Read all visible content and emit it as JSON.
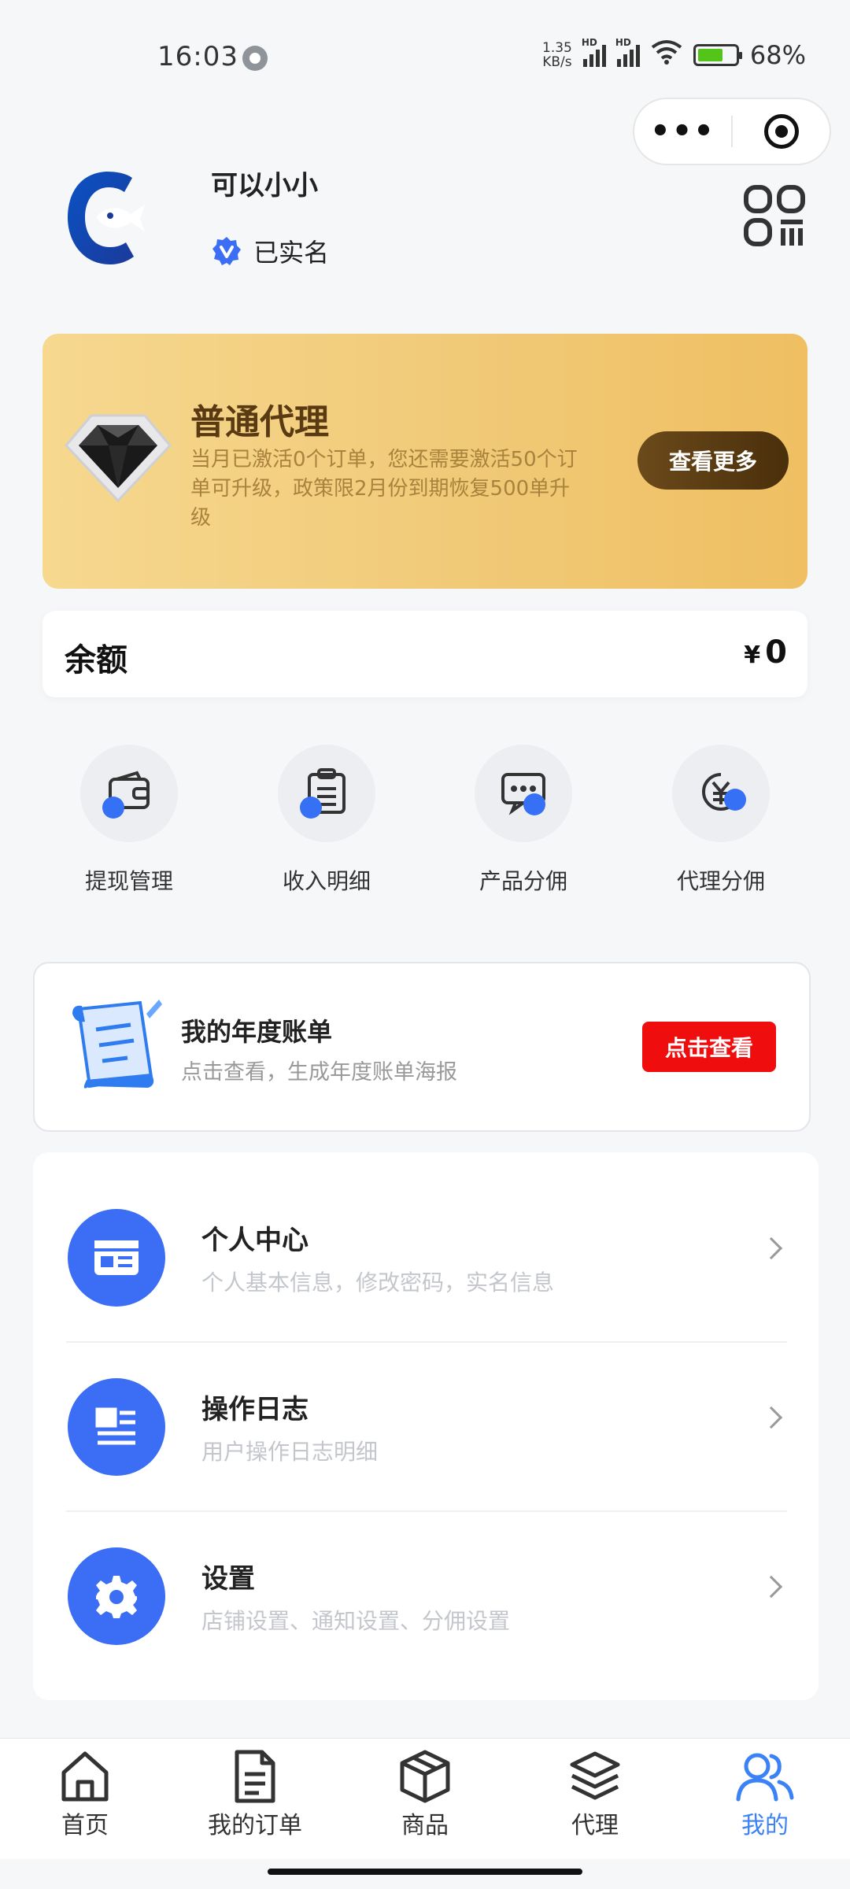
{
  "status_bar": {
    "time": "16:03",
    "net_speed_top": "1.35",
    "net_speed_bottom": "KB/s",
    "battery_pct": "68%"
  },
  "profile": {
    "username": "可以小小",
    "verified_label": "已实名"
  },
  "agent_card": {
    "title": "普通代理",
    "description": "当月已激活0个订单，您还需要激活50个订单可升级，政策限2月份到期恢复500单升级",
    "button": "查看更多"
  },
  "balance": {
    "label": "余额",
    "currency": "¥",
    "value": "0"
  },
  "quick_actions": [
    {
      "label": "提现管理",
      "icon": "wallet-icon"
    },
    {
      "label": "收入明细",
      "icon": "clipboard-icon"
    },
    {
      "label": "产品分佣",
      "icon": "chat-icon"
    },
    {
      "label": "代理分佣",
      "icon": "yen-icon"
    }
  ],
  "annual_bill": {
    "title": "我的年度账单",
    "subtitle": "点击查看，生成年度账单海报",
    "button": "点击查看"
  },
  "menu": [
    {
      "title": "个人中心",
      "subtitle": "个人基本信息，修改密码，实名信息",
      "icon": "id-card-icon"
    },
    {
      "title": "操作日志",
      "subtitle": "用户操作日志明细",
      "icon": "log-icon"
    },
    {
      "title": "设置",
      "subtitle": "店铺设置、通知设置、分佣设置",
      "icon": "gear-icon"
    }
  ],
  "tabs": [
    {
      "label": "首页",
      "icon": "home-icon",
      "active": false
    },
    {
      "label": "我的订单",
      "icon": "document-icon",
      "active": false
    },
    {
      "label": "商品",
      "icon": "box-icon",
      "active": false
    },
    {
      "label": "代理",
      "icon": "layers-icon",
      "active": false
    },
    {
      "label": "我的",
      "icon": "users-icon",
      "active": true
    }
  ],
  "colors": {
    "accent_blue": "#3b6ef5",
    "active_tab": "#3b82f6",
    "bill_button": "#f00d0d",
    "agent_card_gold": "#f1cb7a"
  }
}
